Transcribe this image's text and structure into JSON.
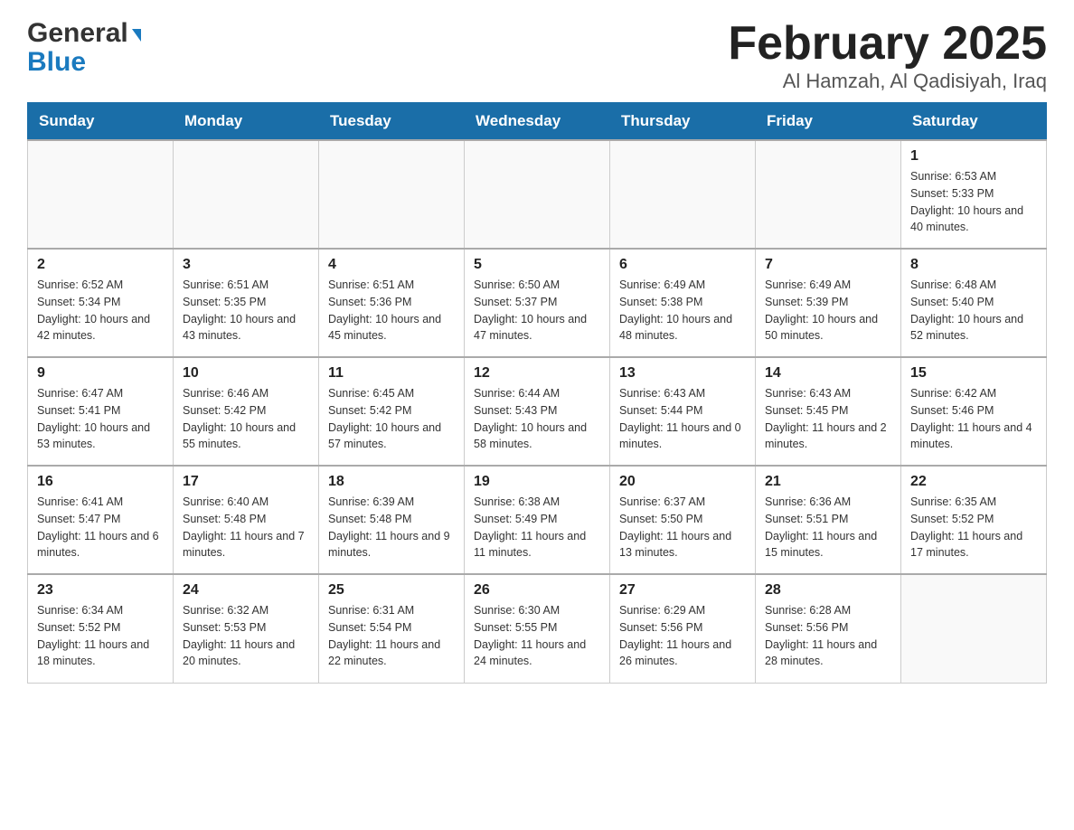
{
  "header": {
    "logo_text1": "General",
    "logo_text2": "Blue",
    "month_title": "February 2025",
    "location": "Al Hamzah, Al Qadisiyah, Iraq"
  },
  "days_of_week": [
    "Sunday",
    "Monday",
    "Tuesday",
    "Wednesday",
    "Thursday",
    "Friday",
    "Saturday"
  ],
  "weeks": [
    {
      "days": [
        {
          "num": "",
          "info": ""
        },
        {
          "num": "",
          "info": ""
        },
        {
          "num": "",
          "info": ""
        },
        {
          "num": "",
          "info": ""
        },
        {
          "num": "",
          "info": ""
        },
        {
          "num": "",
          "info": ""
        },
        {
          "num": "1",
          "info": "Sunrise: 6:53 AM\nSunset: 5:33 PM\nDaylight: 10 hours and 40 minutes."
        }
      ]
    },
    {
      "days": [
        {
          "num": "2",
          "info": "Sunrise: 6:52 AM\nSunset: 5:34 PM\nDaylight: 10 hours and 42 minutes."
        },
        {
          "num": "3",
          "info": "Sunrise: 6:51 AM\nSunset: 5:35 PM\nDaylight: 10 hours and 43 minutes."
        },
        {
          "num": "4",
          "info": "Sunrise: 6:51 AM\nSunset: 5:36 PM\nDaylight: 10 hours and 45 minutes."
        },
        {
          "num": "5",
          "info": "Sunrise: 6:50 AM\nSunset: 5:37 PM\nDaylight: 10 hours and 47 minutes."
        },
        {
          "num": "6",
          "info": "Sunrise: 6:49 AM\nSunset: 5:38 PM\nDaylight: 10 hours and 48 minutes."
        },
        {
          "num": "7",
          "info": "Sunrise: 6:49 AM\nSunset: 5:39 PM\nDaylight: 10 hours and 50 minutes."
        },
        {
          "num": "8",
          "info": "Sunrise: 6:48 AM\nSunset: 5:40 PM\nDaylight: 10 hours and 52 minutes."
        }
      ]
    },
    {
      "days": [
        {
          "num": "9",
          "info": "Sunrise: 6:47 AM\nSunset: 5:41 PM\nDaylight: 10 hours and 53 minutes."
        },
        {
          "num": "10",
          "info": "Sunrise: 6:46 AM\nSunset: 5:42 PM\nDaylight: 10 hours and 55 minutes."
        },
        {
          "num": "11",
          "info": "Sunrise: 6:45 AM\nSunset: 5:42 PM\nDaylight: 10 hours and 57 minutes."
        },
        {
          "num": "12",
          "info": "Sunrise: 6:44 AM\nSunset: 5:43 PM\nDaylight: 10 hours and 58 minutes."
        },
        {
          "num": "13",
          "info": "Sunrise: 6:43 AM\nSunset: 5:44 PM\nDaylight: 11 hours and 0 minutes."
        },
        {
          "num": "14",
          "info": "Sunrise: 6:43 AM\nSunset: 5:45 PM\nDaylight: 11 hours and 2 minutes."
        },
        {
          "num": "15",
          "info": "Sunrise: 6:42 AM\nSunset: 5:46 PM\nDaylight: 11 hours and 4 minutes."
        }
      ]
    },
    {
      "days": [
        {
          "num": "16",
          "info": "Sunrise: 6:41 AM\nSunset: 5:47 PM\nDaylight: 11 hours and 6 minutes."
        },
        {
          "num": "17",
          "info": "Sunrise: 6:40 AM\nSunset: 5:48 PM\nDaylight: 11 hours and 7 minutes."
        },
        {
          "num": "18",
          "info": "Sunrise: 6:39 AM\nSunset: 5:48 PM\nDaylight: 11 hours and 9 minutes."
        },
        {
          "num": "19",
          "info": "Sunrise: 6:38 AM\nSunset: 5:49 PM\nDaylight: 11 hours and 11 minutes."
        },
        {
          "num": "20",
          "info": "Sunrise: 6:37 AM\nSunset: 5:50 PM\nDaylight: 11 hours and 13 minutes."
        },
        {
          "num": "21",
          "info": "Sunrise: 6:36 AM\nSunset: 5:51 PM\nDaylight: 11 hours and 15 minutes."
        },
        {
          "num": "22",
          "info": "Sunrise: 6:35 AM\nSunset: 5:52 PM\nDaylight: 11 hours and 17 minutes."
        }
      ]
    },
    {
      "days": [
        {
          "num": "23",
          "info": "Sunrise: 6:34 AM\nSunset: 5:52 PM\nDaylight: 11 hours and 18 minutes."
        },
        {
          "num": "24",
          "info": "Sunrise: 6:32 AM\nSunset: 5:53 PM\nDaylight: 11 hours and 20 minutes."
        },
        {
          "num": "25",
          "info": "Sunrise: 6:31 AM\nSunset: 5:54 PM\nDaylight: 11 hours and 22 minutes."
        },
        {
          "num": "26",
          "info": "Sunrise: 6:30 AM\nSunset: 5:55 PM\nDaylight: 11 hours and 24 minutes."
        },
        {
          "num": "27",
          "info": "Sunrise: 6:29 AM\nSunset: 5:56 PM\nDaylight: 11 hours and 26 minutes."
        },
        {
          "num": "28",
          "info": "Sunrise: 6:28 AM\nSunset: 5:56 PM\nDaylight: 11 hours and 28 minutes."
        },
        {
          "num": "",
          "info": ""
        }
      ]
    }
  ]
}
